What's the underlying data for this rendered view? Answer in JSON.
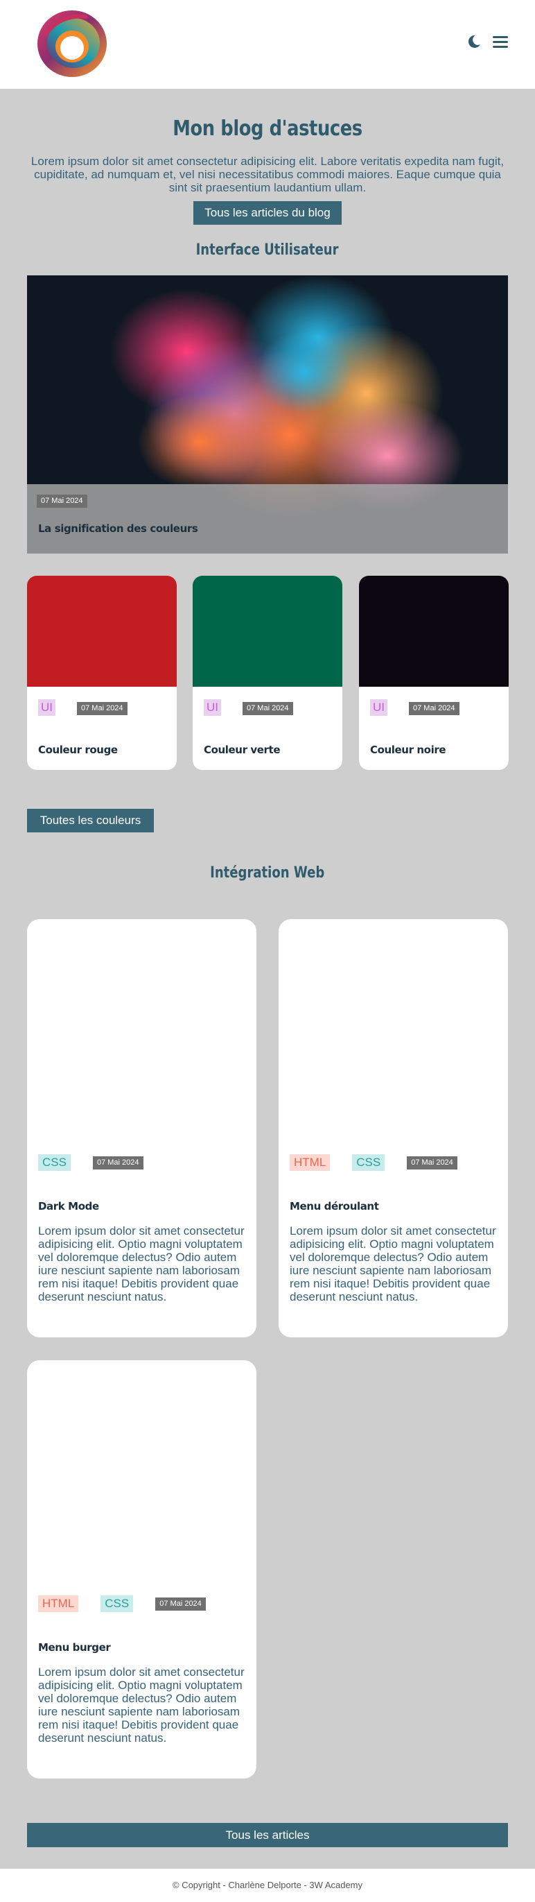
{
  "header": {
    "logo_icon": "swirl-logo",
    "theme_toggle_icon": "moon-icon",
    "menu_icon": "hamburger-icon"
  },
  "hero": {
    "title": "Mon blog d'astuces",
    "intro": "Lorem ipsum dolor sit amet consectetur adipisicing elit. Labore veritatis expedita nam fugit, cupiditate, ad numquam et, vel nisi necessitatibus commodi maiores. Eaque cumque quia sint sit praesentium laudantium ullam.",
    "button_label": "Tous les articles du blog"
  },
  "ui_section": {
    "title": "Interface Utilisateur",
    "featured": {
      "date": "07 Mai 2024",
      "title": "La signification des couleurs"
    },
    "cards": [
      {
        "tag": "UI",
        "date": "07 Mai 2024",
        "title": "Couleur rouge",
        "color": "#c21d21"
      },
      {
        "tag": "UI",
        "date": "07 Mai 2024",
        "title": "Couleur verte",
        "color": "#00664a"
      },
      {
        "tag": "UI",
        "date": "07 Mai 2024",
        "title": "Couleur noire",
        "color": "#0a0710"
      }
    ],
    "button_label": "Toutes les couleurs"
  },
  "web_section": {
    "title": "Intégration Web",
    "cards": [
      {
        "tags": [
          "CSS"
        ],
        "date": "07 Mai 2024",
        "title": "Dark Mode",
        "text": "Lorem ipsum dolor sit amet consectetur adipisicing elit. Optio magni voluptatem vel doloremque delectus? Odio autem iure nesciunt sapiente nam laboriosam rem nisi itaque! Debitis provident quae deserunt nesciunt natus."
      },
      {
        "tags": [
          "HTML",
          "CSS"
        ],
        "date": "07 Mai 2024",
        "title": "Menu déroulant",
        "text": "Lorem ipsum dolor sit amet consectetur adipisicing elit. Optio magni voluptatem vel doloremque delectus? Odio autem iure nesciunt sapiente nam laboriosam rem nisi itaque! Debitis provident quae deserunt nesciunt natus."
      },
      {
        "tags": [
          "HTML",
          "CSS"
        ],
        "date": "07 Mai 2024",
        "title": "Menu burger",
        "text": "Lorem ipsum dolor sit amet consectetur adipisicing elit. Optio magni voluptatem vel doloremque delectus? Odio autem iure nesciunt sapiente nam laboriosam rem nisi itaque! Debitis provident quae deserunt nesciunt natus."
      }
    ],
    "button_label": "Tous les articles"
  },
  "footer": {
    "copyright": "© Copyright - Charlène Delporte - 3W Academy"
  },
  "colors": {
    "accent": "#3a6778",
    "title": "#2f5b6c",
    "background": "#cecece"
  }
}
